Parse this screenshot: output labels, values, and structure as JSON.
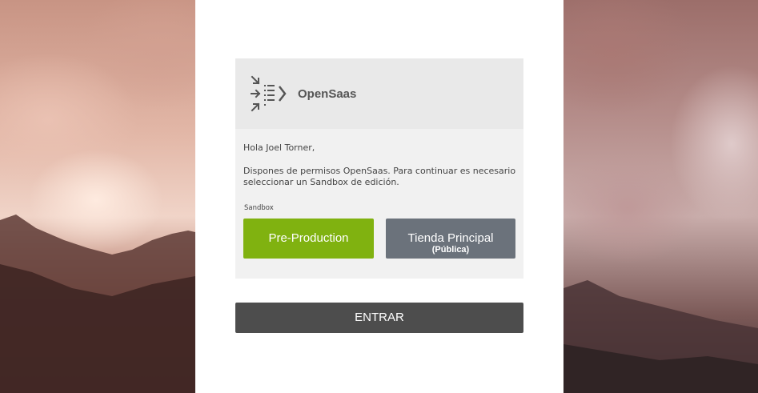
{
  "brand": {
    "name": "OpenSaas",
    "icon": "opensaas-logo-icon"
  },
  "greeting": "Hola Joel Torner,",
  "message": "Dispones de permisos OpenSaas. Para continuar es necesario seleccionar un Sandbox de edición.",
  "sandbox": {
    "label": "Sandbox",
    "options": [
      {
        "label": "Pre-Production",
        "color": "#80b210"
      },
      {
        "label": "Tienda Principal",
        "sublabel": "(Pública)",
        "color": "#6b727b"
      }
    ]
  },
  "submit": {
    "label": "ENTRAR",
    "color": "#4d4d4d"
  }
}
